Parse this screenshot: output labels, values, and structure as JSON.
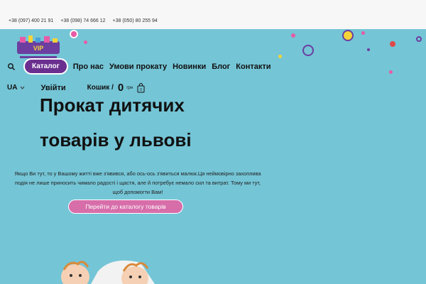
{
  "header": {
    "phones": [
      "+38 (097) 400 21 91",
      "+38 (098) 74 666 12",
      "+38 (050) 80 255 94"
    ]
  },
  "nav": {
    "catalog_label": "Каталог",
    "items": [
      {
        "label": "Про нас"
      },
      {
        "label": "Умови прокату"
      },
      {
        "label": "Новинки"
      },
      {
        "label": "Блог"
      },
      {
        "label": "Контакти"
      }
    ]
  },
  "account": {
    "lang": "UA",
    "login_label": "Увійти",
    "cart_label": "Кошик /",
    "cart_total": "0",
    "cart_currency": "грн",
    "cart_count": "0"
  },
  "hero": {
    "title_line1": "Прокат дитячих",
    "title_line2": "товарів у львові",
    "description": "Якщо Ви тут, то у Вашому житті вже з'явився, або ось-ось з'явиться малюк.Ця неймовірно захоплива подія не лише приносить чимало радості і щастя, але й потребує немало сил та витрат. Тому ми тут, щоб допомогти Вам!",
    "cta_label": "Перейти до каталогу товарів"
  },
  "colors": {
    "background": "#74c5d6",
    "catalog_button": "#6a2f8f",
    "cta_button": "#d76eaa"
  }
}
